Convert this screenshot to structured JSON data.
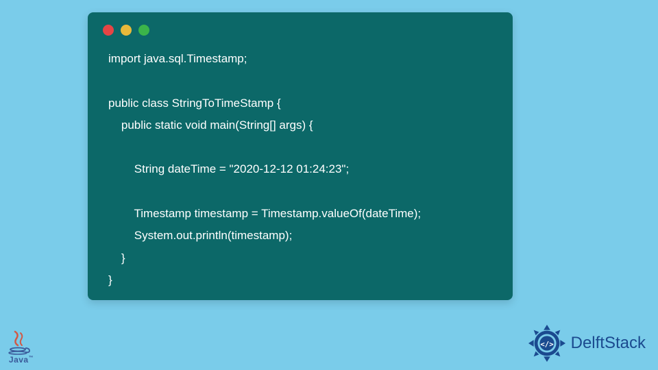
{
  "code": {
    "lines": [
      "import java.sql.Timestamp;",
      "",
      "public class StringToTimeStamp {",
      "    public static void main(String[] args) {",
      "",
      "        String dateTime = \"2020-12-12 01:24:23\";",
      "",
      "        Timestamp timestamp = Timestamp.valueOf(dateTime);",
      "        System.out.println(timestamp);",
      "    }",
      "}"
    ]
  },
  "logos": {
    "java_label": "Java",
    "delft_label": "DelftStack"
  },
  "colors": {
    "background": "#7accea",
    "window": "#0c6868",
    "text": "#ffffff",
    "delft": "#1b4a8f"
  }
}
